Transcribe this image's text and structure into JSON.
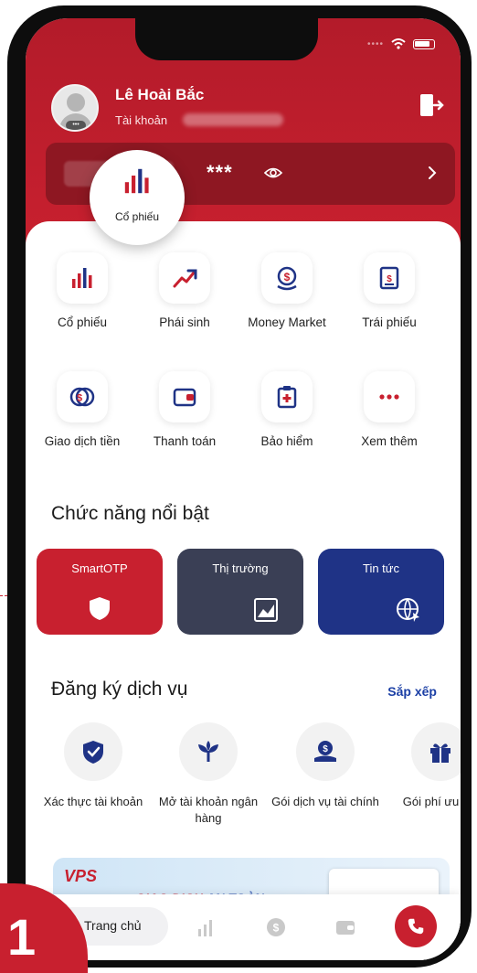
{
  "user": {
    "name": "Lê Hoài Bắc",
    "account_label": "Tài khoản"
  },
  "balance": {
    "masked": "***"
  },
  "tooltip": {
    "label": "Cổ phiếu"
  },
  "menu": [
    {
      "label": "Cổ phiếu",
      "icon": "stock-chart-icon"
    },
    {
      "label": "Phái sinh",
      "icon": "trend-up-icon"
    },
    {
      "label": "Money Market",
      "icon": "money-market-icon"
    },
    {
      "label": "Trái phiếu",
      "icon": "bond-icon"
    },
    {
      "label": "Giao dịch tiền",
      "icon": "coins-icon"
    },
    {
      "label": "Thanh toán",
      "icon": "wallet-icon"
    },
    {
      "label": "Bảo hiểm",
      "icon": "insurance-icon"
    },
    {
      "label": "Xem thêm",
      "icon": "more-icon"
    }
  ],
  "features": {
    "title": "Chức năng nổi bật",
    "items": [
      {
        "label": "SmartOTP",
        "icon": "shield-icon",
        "color": "#c8202f"
      },
      {
        "label": "Thị trường",
        "icon": "market-chart-icon",
        "color": "#3a3f55"
      },
      {
        "label": "Tin tức",
        "icon": "globe-icon",
        "color": "#1f3386"
      }
    ]
  },
  "services": {
    "title": "Đăng ký dịch vụ",
    "sort_label": "Sắp xếp",
    "items": [
      {
        "label": "Xác thực tài khoản",
        "icon": "verify-shield-icon"
      },
      {
        "label": "Mở tài khoản ngân hàng",
        "icon": "bank-plant-icon"
      },
      {
        "label": "Gói dịch vụ tài chính",
        "icon": "coin-hand-icon"
      },
      {
        "label": "Gói phí ưu đãi",
        "icon": "gift-icon"
      }
    ]
  },
  "banner": {
    "logo": "VPS",
    "text_prefix": "GIAO DỊCH",
    "text_highlight": "AN TOÀN"
  },
  "tabbar": {
    "home_label": "Trang chủ",
    "icons": [
      "home-icon",
      "market-tab-icon",
      "money-tab-icon",
      "wallet-tab-icon",
      "phone-icon"
    ]
  },
  "step": {
    "number": "1"
  },
  "colors": {
    "brand_red": "#c8202f",
    "navy": "#1f3386",
    "slate": "#3a3f55"
  }
}
